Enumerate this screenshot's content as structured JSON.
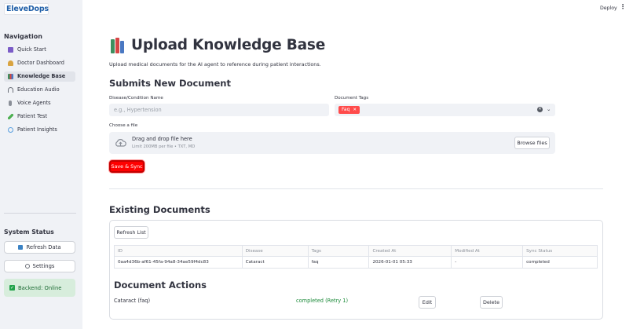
{
  "app": {
    "logo_text": "EleveDops"
  },
  "header": {
    "deploy_label": "Deploy",
    "menu_icon": "kebab-menu-icon"
  },
  "sidebar": {
    "nav_title": "Navigation",
    "items": [
      {
        "label": "Quick Start",
        "icon": "book-icon",
        "color": "#7b5cc7"
      },
      {
        "label": "Doctor Dashboard",
        "icon": "doctor-icon",
        "color": "#d9a441"
      },
      {
        "label": "Knowledge Base",
        "icon": "books-icon",
        "color": "#3d8f5f",
        "active": true
      },
      {
        "label": "Education Audio",
        "icon": "headphones-icon",
        "color": "#6b6f78"
      },
      {
        "label": "Voice Agents",
        "icon": "microphone-icon",
        "color": "#8a8f98"
      },
      {
        "label": "Patient Test",
        "icon": "test-tube-icon",
        "color": "#4caf50"
      },
      {
        "label": "Patient Insights",
        "icon": "insights-icon",
        "color": "#5aa0e0"
      }
    ],
    "system_status_title": "System Status",
    "refresh_data_label": "Refresh Data",
    "settings_label": "Settings",
    "backend_status": "Backend: Online"
  },
  "main": {
    "title": "Upload Knowledge Base",
    "description": "Upload medical documents for the AI agent to reference during patient interactions.",
    "submit_heading": "Submits New Document",
    "disease_label": "Disease/Condition Name",
    "disease_placeholder": "e.g., Hypertension",
    "tags_label": "Document Tags",
    "tags": [
      "Faq"
    ],
    "file_label": "Choose a file",
    "dropzone_text": "Drag and drop file here",
    "dropzone_subtext": "Limit 200MB per file • TXT, MD",
    "browse_label": "Browse files",
    "save_label": "Save & Sync",
    "existing_heading": "Existing Documents",
    "refresh_list_label": "Refresh List",
    "table": {
      "columns": [
        "ID",
        "Disease",
        "Tags",
        "Created At",
        "Modified At",
        "Sync Status"
      ],
      "rows": [
        [
          "0aa4d36b-af61-45fa-94a8-34ae59f4dc83",
          "Cataract",
          "faq",
          "2026-01-01 05:33",
          "-",
          "completed"
        ]
      ]
    },
    "actions_heading": "Document Actions",
    "action_item_label": "Cataract (faq)",
    "action_item_status": "completed (Retry 1)",
    "edit_label": "Edit",
    "delete_label": "Delete"
  }
}
